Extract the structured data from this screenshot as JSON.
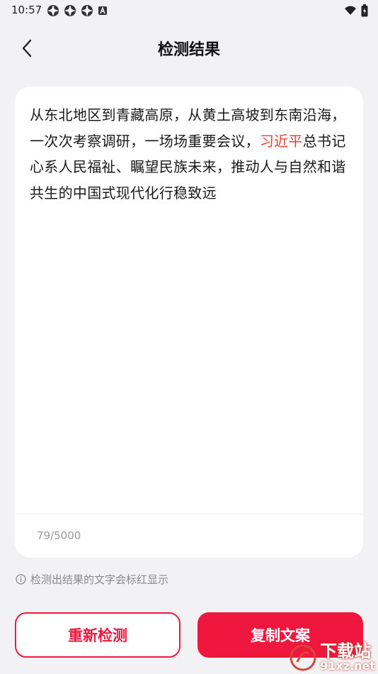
{
  "status_bar": {
    "time": "10:57"
  },
  "nav": {
    "title": "检测结果"
  },
  "result": {
    "before": "从东北地区到青藏高原，从黄土高坡到东南沿海，一次次考察调研，一场场重要会议，",
    "highlighted": "习近平",
    "after": "总书记心系人民福祉、瞩望民族未来，推动人与自然和谐共生的中国式现代化行稳致远",
    "char_count": "79/5000"
  },
  "hint": {
    "text": "检测出结果的文字会标红显示"
  },
  "buttons": {
    "redetect_label": "重新检测",
    "copy_label": "复制文案"
  },
  "watermark": {
    "brand": "下载站",
    "domain": "91xz.net"
  },
  "colors": {
    "accent": "#f0173f",
    "highlight": "#e8433a",
    "background": "#f2f2f4"
  }
}
